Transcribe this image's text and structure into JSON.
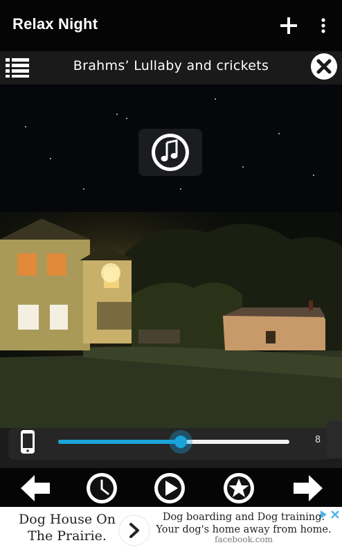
{
  "app": {
    "title": "Relax Night"
  },
  "toolbar": {
    "add_icon": "plus-icon",
    "menu_icon": "more-vert-icon"
  },
  "track": {
    "title": "Brahms’ Lullaby and crickets",
    "list_icon": "list-icon",
    "close_icon": "close-circle-icon"
  },
  "music_button": {
    "icon": "music-note-icon"
  },
  "scene": {
    "image": "night-house-scene"
  },
  "controls": {
    "phone_icon": "phone-icon",
    "volume_level": 0.53,
    "side_number": "8"
  },
  "nav": {
    "buttons": [
      {
        "icon": "arrow-left-icon"
      },
      {
        "icon": "clock-icon"
      },
      {
        "icon": "play-icon"
      },
      {
        "icon": "star-icon"
      },
      {
        "icon": "arrow-right-icon"
      }
    ]
  },
  "ad": {
    "left_text": "Dog House On The Prairie.",
    "right_text": "Dog boarding and Dog training. Your dog's home away from home.",
    "source": "facebook.com",
    "colors": {
      "accent": "#1aa3d9",
      "badge": "#4fb3e6"
    }
  }
}
